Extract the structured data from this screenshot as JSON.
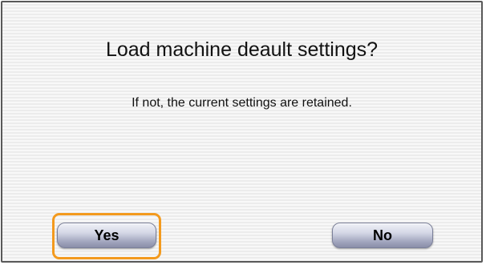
{
  "dialog": {
    "title": "Load machine deault settings?",
    "message": "If not, the current settings are retained.",
    "buttons": {
      "yes_label": "Yes",
      "no_label": "No"
    },
    "focused_button": "Yes",
    "colors": {
      "focus_ring": "#f39a1e",
      "border": "#595959",
      "button_gradient_top": "#f0f1f7",
      "button_gradient_bottom": "#8a8ea8"
    }
  }
}
